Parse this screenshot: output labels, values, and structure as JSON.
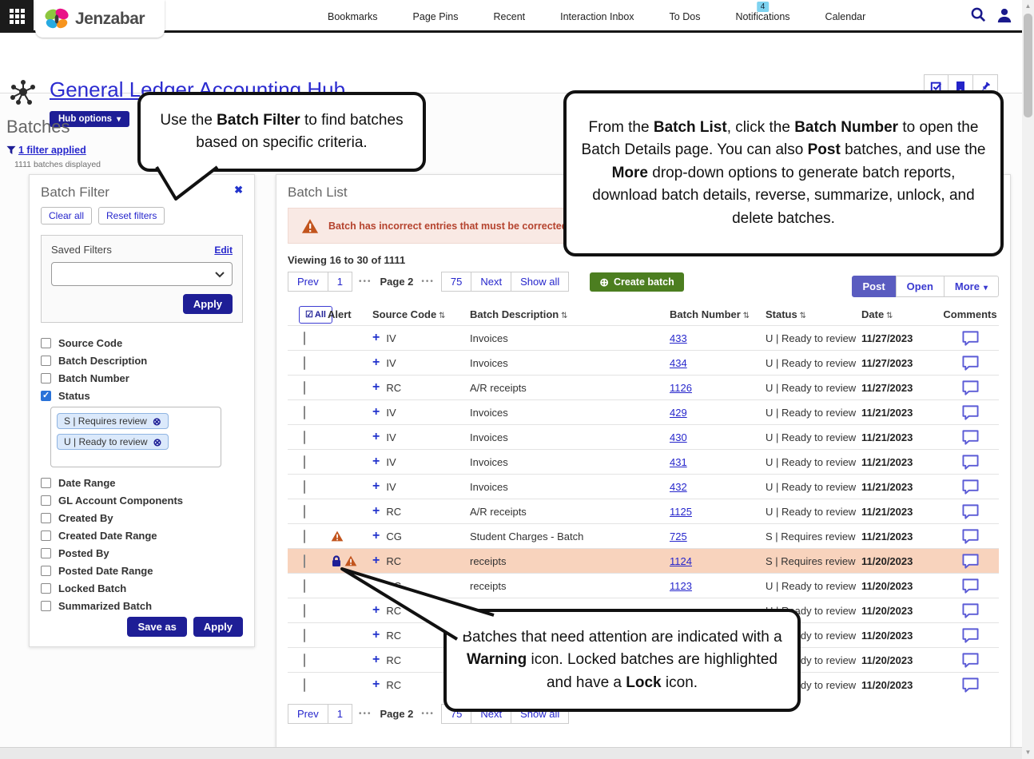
{
  "topnav": {
    "brand": "Jenzabar",
    "items": [
      "Bookmarks",
      "Page Pins",
      "Recent",
      "Interaction Inbox",
      "To Dos",
      "Notifications",
      "Calendar"
    ],
    "notifications_badge": "4"
  },
  "header": {
    "title": "General Ledger Accounting Hub",
    "hub_options": "Hub options"
  },
  "batches_panel": {
    "heading": "Batches",
    "filter_applied": "1 filter applied",
    "batches_displayed": "1111 batches displayed"
  },
  "filter_panel": {
    "title": "Batch Filter",
    "clear_all": "Clear all",
    "reset_filters": "Reset filters",
    "saved_filters_label": "Saved Filters",
    "edit": "Edit",
    "apply": "Apply",
    "checkboxes": [
      {
        "label": "Source Code",
        "checked": false
      },
      {
        "label": "Batch Description",
        "checked": false
      },
      {
        "label": "Batch Number",
        "checked": false
      },
      {
        "label": "Status",
        "checked": true
      },
      {
        "label": "Date Range",
        "checked": false
      },
      {
        "label": "GL Account Components",
        "checked": false
      },
      {
        "label": "Created By",
        "checked": false
      },
      {
        "label": "Created Date Range",
        "checked": false
      },
      {
        "label": "Posted By",
        "checked": false
      },
      {
        "label": "Posted Date Range",
        "checked": false
      },
      {
        "label": "Locked Batch",
        "checked": false
      },
      {
        "label": "Summarized Batch",
        "checked": false
      }
    ],
    "status_chips": [
      "S | Requires review",
      "U | Ready to review"
    ],
    "save_as": "Save as"
  },
  "batch_list": {
    "title": "Batch List",
    "warning_message": "Batch has incorrect entries that must be corrected before post",
    "viewing": "Viewing 16 to 30 of 1111",
    "pagination": {
      "prev": "Prev",
      "first": "1",
      "ellipsis": "•••",
      "page_label": "Page 2",
      "last": "75",
      "next": "Next",
      "show_all": "Show all"
    },
    "create_batch": "Create batch",
    "actions": {
      "post": "Post",
      "open": "Open",
      "more": "More"
    },
    "columns": [
      "All",
      "Alert",
      "Source Code",
      "Batch Description",
      "Batch Number",
      "Status",
      "Date",
      "Comments"
    ],
    "rows": [
      {
        "alert": "",
        "source": "IV",
        "description": "Invoices",
        "number": "433",
        "status": "U | Ready to review",
        "date": "11/27/2023",
        "highlighted": false
      },
      {
        "alert": "",
        "source": "IV",
        "description": "Invoices",
        "number": "434",
        "status": "U | Ready to review",
        "date": "11/27/2023",
        "highlighted": false
      },
      {
        "alert": "",
        "source": "RC",
        "description": "A/R receipts",
        "number": "1126",
        "status": "U | Ready to review",
        "date": "11/27/2023",
        "highlighted": false
      },
      {
        "alert": "",
        "source": "IV",
        "description": "Invoices",
        "number": "429",
        "status": "U | Ready to review",
        "date": "11/21/2023",
        "highlighted": false
      },
      {
        "alert": "",
        "source": "IV",
        "description": "Invoices",
        "number": "430",
        "status": "U | Ready to review",
        "date": "11/21/2023",
        "highlighted": false
      },
      {
        "alert": "",
        "source": "IV",
        "description": "Invoices",
        "number": "431",
        "status": "U | Ready to review",
        "date": "11/21/2023",
        "highlighted": false
      },
      {
        "alert": "",
        "source": "IV",
        "description": "Invoices",
        "number": "432",
        "status": "U | Ready to review",
        "date": "11/21/2023",
        "highlighted": false
      },
      {
        "alert": "",
        "source": "RC",
        "description": "A/R receipts",
        "number": "1125",
        "status": "U | Ready to review",
        "date": "11/21/2023",
        "highlighted": false
      },
      {
        "alert": "warning",
        "source": "CG",
        "description": "Student Charges - Batch",
        "number": "725",
        "status": "S | Requires review",
        "date": "11/21/2023",
        "highlighted": false
      },
      {
        "alert": "lock-warning",
        "source": "RC",
        "description": "receipts",
        "number": "1124",
        "status": "S | Requires review",
        "date": "11/20/2023",
        "highlighted": true
      },
      {
        "alert": "",
        "source": "RC",
        "description": "receipts",
        "number": "1123",
        "status": "U | Ready to review",
        "date": "11/20/2023",
        "highlighted": false
      },
      {
        "alert": "",
        "source": "RC",
        "description": "",
        "number": "",
        "status": "U | Ready to review",
        "date": "11/20/2023",
        "highlighted": false
      },
      {
        "alert": "",
        "source": "RC",
        "description": "",
        "number": "",
        "status": "U | Ready to review",
        "date": "11/20/2023",
        "highlighted": false
      },
      {
        "alert": "",
        "source": "RC",
        "description": "",
        "number": "",
        "status": "U | Ready to review",
        "date": "11/20/2023",
        "highlighted": false
      },
      {
        "alert": "",
        "source": "RC",
        "description": "",
        "number": "",
        "status": "U | Ready to review",
        "date": "11/20/2023",
        "highlighted": false
      }
    ]
  },
  "callouts": {
    "c1": {
      "p1": "Use the ",
      "b1": "Batch Filter",
      "p2": " to find batches based on specific criteria."
    },
    "c2": {
      "p1": "From the ",
      "b1": "Batch List",
      "p2": ", click the ",
      "b2": "Batch Number",
      "p3": " to open the Batch Details page. You can also ",
      "b3": "Post",
      "p4": " batches, and use the ",
      "b4": "More",
      "p5": " drop-down options to generate batch reports, download batch details, reverse, summarize, unlock, and delete batches."
    },
    "c3": {
      "p1": "Batches that need attention are indicated with a ",
      "b1": "Warning",
      "p2": " icon. Locked batches are highlighted and have a ",
      "b2": "Lock",
      "p3": " icon."
    }
  },
  "colors": {
    "navy_button": "#1e1e96",
    "link_blue": "#2626cc",
    "post_purple": "#5a5cc0",
    "create_green": "#4c7e20",
    "row_highlight": "#f8d3bd",
    "warning_text": "#b5432e",
    "warning_banner_bg": "#f9e9e4",
    "warning_icon": "#c2541d",
    "chip_bg": "#dbe9fb",
    "badge_blue": "#7ed3f0"
  }
}
